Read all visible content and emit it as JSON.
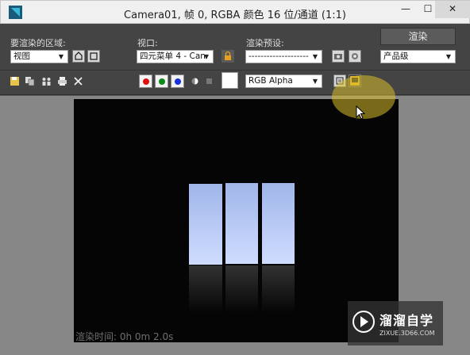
{
  "window": {
    "title": "Camera01, 帧 0, RGBA 颜色 16 位/通道 (1:1)",
    "min_glyph": "—",
    "max_glyph": "☐",
    "close_glyph": "✕"
  },
  "panel": {
    "area_label": "要渲染的区域:",
    "area_value": "视图",
    "viewport_label": "视口:",
    "viewport_value": "四元菜单 4 - Can",
    "preset_label": "渲染预设:",
    "preset_value": "--------------------",
    "render_label": "渲染",
    "quality_value": "产品级",
    "channel_value": "RGB Alpha"
  },
  "channels": {
    "red": "#e01010",
    "green": "#0b8a1a",
    "blue": "#1730d8"
  },
  "icons": [
    "save-icon",
    "copy-icon",
    "clone-icon",
    "print-icon",
    "clear-icon",
    "lock-icon",
    "mono-icon",
    "alpha-icon"
  ],
  "viewport": {
    "render_time": "渲染时间: 0h 0m 2.0s"
  },
  "watermark": {
    "title": "溜溜自学",
    "url": "ZIXUE.3D66.COM"
  }
}
